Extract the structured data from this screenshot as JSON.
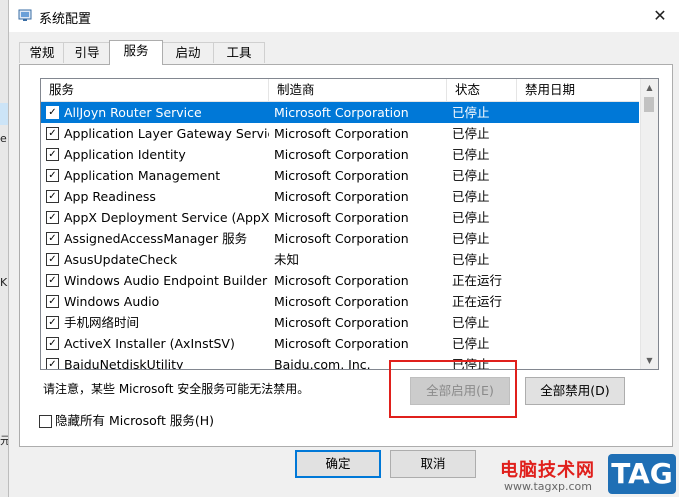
{
  "window": {
    "title": "系统配置",
    "close_glyph": "✕"
  },
  "tabs": [
    {
      "label": "常规",
      "active": false
    },
    {
      "label": "引导",
      "active": false
    },
    {
      "label": "服务",
      "active": true
    },
    {
      "label": "启动",
      "active": false
    },
    {
      "label": "工具",
      "active": false
    }
  ],
  "services": {
    "columns": [
      "服务",
      "制造商",
      "状态",
      "禁用日期"
    ],
    "rows": [
      {
        "name": "AllJoyn Router Service",
        "vendor": "Microsoft Corporation",
        "status": "已停止",
        "checked": true,
        "selected": true
      },
      {
        "name": "Application Layer Gateway Service",
        "vendor": "Microsoft Corporation",
        "status": "已停止",
        "checked": true
      },
      {
        "name": "Application Identity",
        "vendor": "Microsoft Corporation",
        "status": "已停止",
        "checked": true
      },
      {
        "name": "Application Management",
        "vendor": "Microsoft Corporation",
        "status": "已停止",
        "checked": true
      },
      {
        "name": "App Readiness",
        "vendor": "Microsoft Corporation",
        "status": "已停止",
        "checked": true
      },
      {
        "name": "AppX Deployment Service (AppX...",
        "vendor": "Microsoft Corporation",
        "status": "已停止",
        "checked": true
      },
      {
        "name": "AssignedAccessManager 服务",
        "vendor": "Microsoft Corporation",
        "status": "已停止",
        "checked": true
      },
      {
        "name": "AsusUpdateCheck",
        "vendor": "未知",
        "status": "已停止",
        "checked": true
      },
      {
        "name": "Windows Audio Endpoint Builder",
        "vendor": "Microsoft Corporation",
        "status": "正在运行",
        "checked": true
      },
      {
        "name": "Windows Audio",
        "vendor": "Microsoft Corporation",
        "status": "正在运行",
        "checked": true
      },
      {
        "name": "手机网络时间",
        "vendor": "Microsoft Corporation",
        "status": "已停止",
        "checked": true
      },
      {
        "name": "ActiveX Installer (AxInstSV)",
        "vendor": "Microsoft Corporation",
        "status": "已停止",
        "checked": true
      },
      {
        "name": "BaiduNetdiskUtility",
        "vendor": "Baidu.com, Inc.",
        "status": "已停止",
        "checked": true
      }
    ]
  },
  "note": "请注意，某些 Microsoft 安全服务可能无法禁用。",
  "buttons": {
    "enable_all": "全部启用(E)",
    "disable_all": "全部禁用(D)",
    "ok": "确定",
    "cancel": "取消"
  },
  "hide_ms": {
    "label": "隐藏所有 Microsoft 服务(H)",
    "checked": false
  },
  "left_strip": {
    "glyph1": "e",
    "glyph2": "KS",
    "glyph3": "元"
  },
  "watermark": {
    "line1": "电脑技术网",
    "line2": "www.tagxp.com",
    "badge": "TAG"
  },
  "colors": {
    "selection": "#0078d7",
    "highlight_box": "#e0201c"
  }
}
